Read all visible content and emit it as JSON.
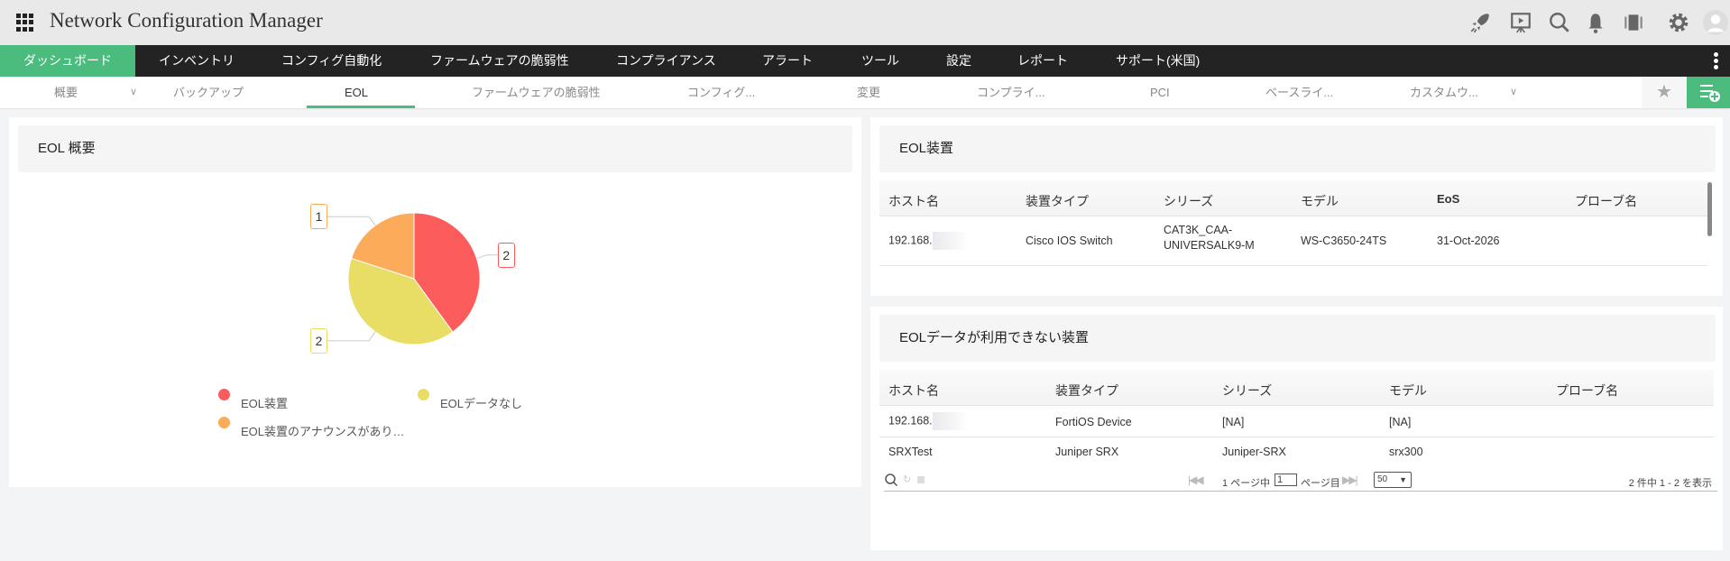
{
  "app": {
    "title": "Network Configuration Manager"
  },
  "header_icons": [
    "rocket-icon",
    "presentation-icon",
    "search-icon",
    "bell-icon",
    "devices-icon",
    "gear-icon",
    "avatar-icon"
  ],
  "nav": {
    "items": [
      "ダッシュボード",
      "インベントリ",
      "コンフィグ自動化",
      "ファームウェアの脆弱性",
      "コンプライアンス",
      "アラート",
      "ツール",
      "設定",
      "レポート",
      "サポート(米国)"
    ],
    "active": 0
  },
  "subnav": {
    "items": [
      "概要",
      "バックアップ",
      "EOL",
      "ファームウェアの脆弱性",
      "コンフィグ...",
      "変更",
      "コンプライ...",
      "PCI",
      "ベースライ...",
      "カスタムウ..."
    ],
    "active": 2
  },
  "colors": {
    "accent": "#4bbb7e",
    "eol": "#fc5c5c",
    "no_data": "#e8de65",
    "announced": "#fbab5a"
  },
  "overview": {
    "title": "EOL 概要",
    "chart_data": {
      "type": "pie",
      "title": "EOL 概要",
      "slices": [
        {
          "label": "EOL装置",
          "value": 2,
          "color": "#fc5c5c"
        },
        {
          "label": "EOLデータなし",
          "value": 2,
          "color": "#e8de65"
        },
        {
          "label": "EOL装置のアナウンスがあり…",
          "value": 1,
          "color": "#fbab5a"
        }
      ],
      "legend": "bottom"
    }
  },
  "eol_devices": {
    "title": "EOL装置",
    "columns": [
      "ホスト名",
      "装置タイプ",
      "シリーズ",
      "モデル",
      "EoS",
      "プローブ名"
    ],
    "rows": [
      [
        "192.168.",
        "Cisco IOS Switch",
        "CAT3K_CAA-\nUNIVERSALK9-M",
        "WS-C3650-24TS",
        "31-Oct-2026",
        ""
      ]
    ]
  },
  "no_eol_devices": {
    "title": "EOLデータが利用できない装置",
    "columns": [
      "ホスト名",
      "装置タイプ",
      "シリーズ",
      "モデル",
      "プローブ名"
    ],
    "rows": [
      [
        "192.168.",
        "FortiOS Device",
        "[NA]",
        "[NA]",
        ""
      ],
      [
        "SRXTest",
        "Juniper SRX",
        "Juniper-SRX",
        "srx300",
        ""
      ]
    ],
    "pager": {
      "of_pages": "1 ページ中",
      "page": "1",
      "page_suffix": "ページ目",
      "page_size": "50",
      "summary": "2 件中 1 - 2 を表示"
    }
  }
}
